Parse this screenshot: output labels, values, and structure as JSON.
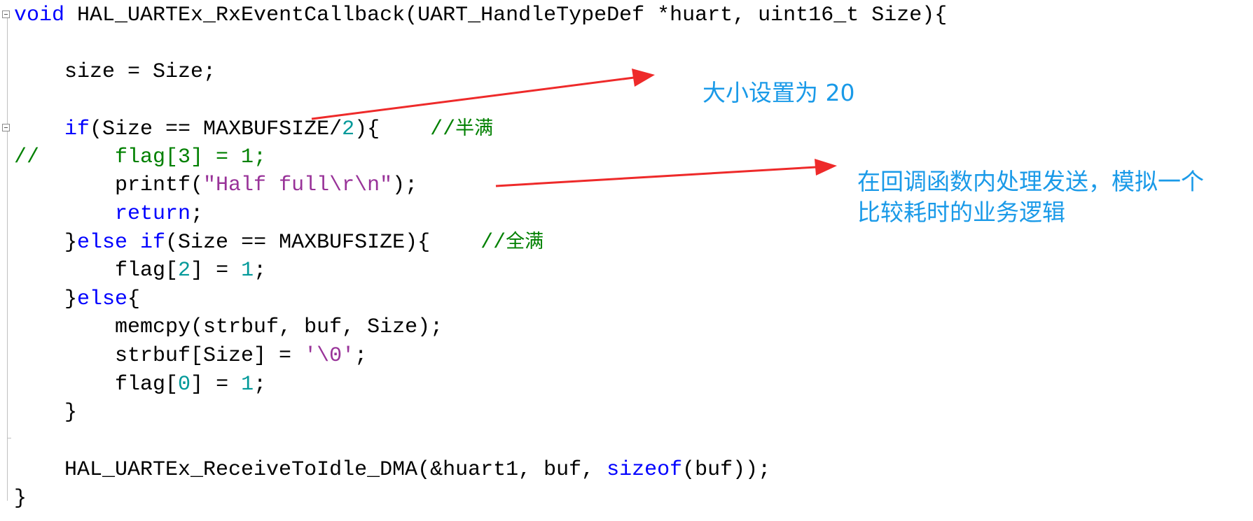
{
  "code": {
    "l1": [
      "void",
      " HAL_UARTEx_RxEventCallback(UART_HandleTypeDef *huart, uint16_t Size){"
    ],
    "l3": [
      "    size = Size;"
    ],
    "l5": [
      "    ",
      "if",
      "(Size == MAXBUFSIZE/",
      "2",
      "){    ",
      "//",
      "半满"
    ],
    "l6": [
      "//      flag[3] = 1;"
    ],
    "l7": [
      "        printf(",
      "\"Half full\\r\\n\"",
      ");"
    ],
    "l8": [
      "        ",
      "return",
      ";"
    ],
    "l9": [
      "    }",
      "else if",
      "(Size == MAXBUFSIZE){    ",
      "//",
      "全满"
    ],
    "l10": [
      "        flag[",
      "2",
      "] = ",
      "1",
      ";"
    ],
    "l11": [
      "    }",
      "else",
      "{"
    ],
    "l12": [
      "        memcpy(strbuf, buf, Size);"
    ],
    "l13": [
      "        strbuf[Size] = ",
      "'\\0'",
      ";"
    ],
    "l14": [
      "        flag[",
      "0",
      "] = ",
      "1",
      ";"
    ],
    "l15": [
      "    }"
    ],
    "l17": [
      "    HAL_UARTEx_ReceiveToIdle_DMA(&huart1, buf, ",
      "sizeof",
      "(buf));"
    ],
    "l18": [
      "}"
    ]
  },
  "annotations": {
    "note1": "大小设置为 20",
    "note2_line1": "在回调函数内处理发送，模拟一个",
    "note2_line2": "比较耗时的业务逻辑",
    "color": "#1a9ae8",
    "arrow_color": "#ee2a2a"
  }
}
